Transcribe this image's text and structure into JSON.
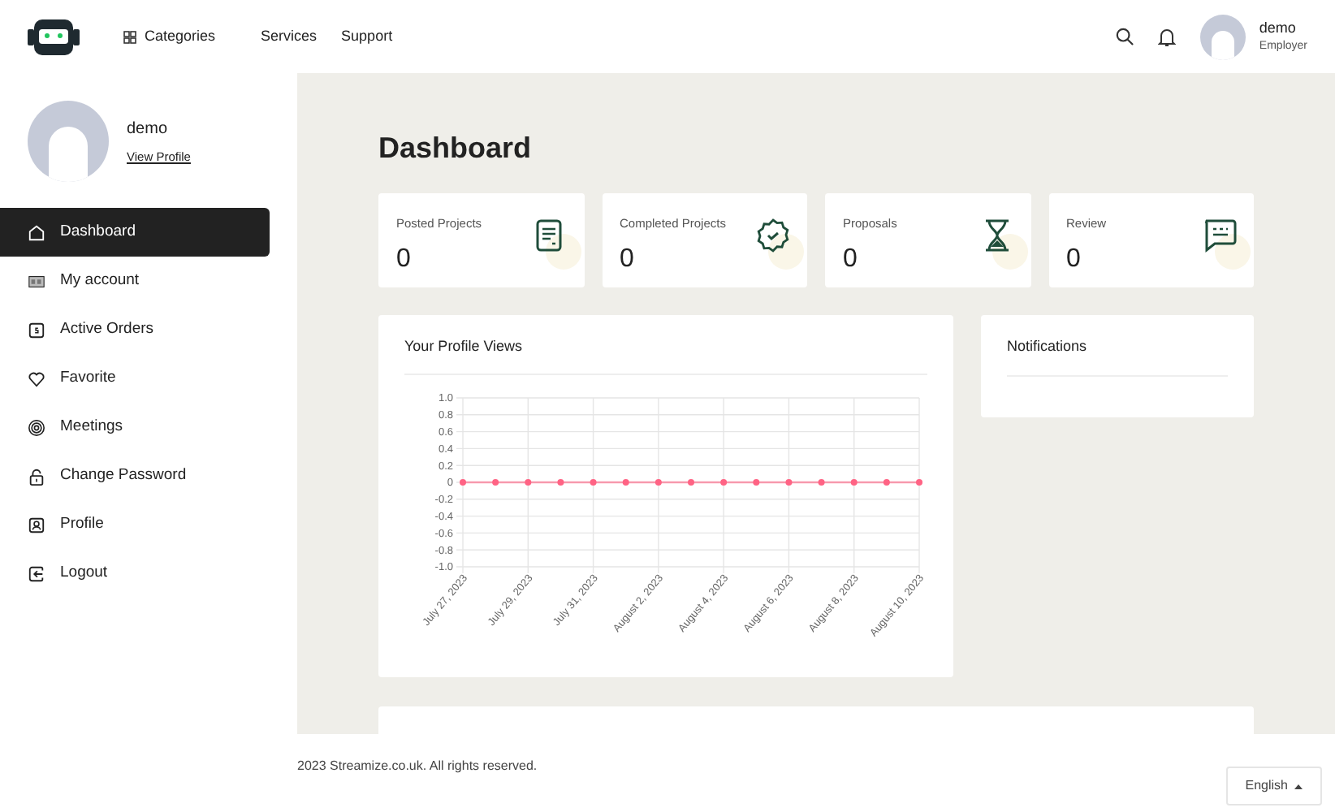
{
  "header": {
    "nav": [
      {
        "label": "Categories",
        "kind": "grid"
      },
      {
        "label": "Services",
        "kind": "plain"
      },
      {
        "label": "Support",
        "kind": "plain"
      }
    ],
    "user": {
      "name": "demo",
      "role": "Employer"
    }
  },
  "sidebar": {
    "user": {
      "name": "demo",
      "link": "View Profile"
    },
    "items": [
      {
        "label": "Dashboard",
        "selected": true
      },
      {
        "label": "My account",
        "selected": false
      },
      {
        "label": "Active Orders",
        "selected": false
      },
      {
        "label": "Favorite",
        "selected": false
      },
      {
        "label": "Meetings",
        "selected": false
      },
      {
        "label": "Change Password",
        "selected": false
      },
      {
        "label": "Profile",
        "selected": false
      },
      {
        "label": "Logout",
        "selected": false
      }
    ]
  },
  "page_title": "Dashboard",
  "stats": [
    {
      "label": "Posted Projects",
      "value": "0"
    },
    {
      "label": "Completed Projects",
      "value": "0"
    },
    {
      "label": "Proposals",
      "value": "0"
    },
    {
      "label": "Review",
      "value": "0"
    }
  ],
  "profile_views": {
    "title": "Your Profile Views",
    "chart_data": {
      "type": "line",
      "categories": [
        "July 27, 2023",
        null,
        "July 29, 2023",
        null,
        "July 31, 2023",
        null,
        "August 2, 2023",
        null,
        "August 4, 2023",
        null,
        "August 6, 2023",
        null,
        "August 8, 2023",
        null,
        "August 10, 2023"
      ],
      "grid": true,
      "series": [
        {
          "color": "#ff6384",
          "marker": true,
          "values": [
            0,
            0,
            0,
            0,
            0,
            0,
            0,
            0,
            0,
            0,
            0,
            0,
            0,
            0,
            0
          ]
        }
      ],
      "ylim": [
        -1,
        1
      ],
      "yticks": [
        {
          "value": 1,
          "label": "1.0"
        },
        {
          "value": 0.8,
          "label": "0.8"
        },
        {
          "value": 0.6,
          "label": "0.6"
        },
        {
          "value": 0.4,
          "label": "0.4"
        },
        {
          "value": 0.2,
          "label": "0.2"
        },
        {
          "value": 0,
          "label": "0"
        },
        {
          "value": -0.2,
          "label": "-0.2"
        },
        {
          "value": -0.4,
          "label": "-0.4"
        },
        {
          "value": -0.6,
          "label": "-0.6"
        },
        {
          "value": -0.8,
          "label": "-0.8"
        },
        {
          "value": -1,
          "label": "-1.0"
        }
      ]
    }
  },
  "notifications": {
    "title": "Notifications"
  },
  "footer": {
    "copyright": "2023 Streamize.co.uk. All rights reserved.",
    "language": "English"
  }
}
